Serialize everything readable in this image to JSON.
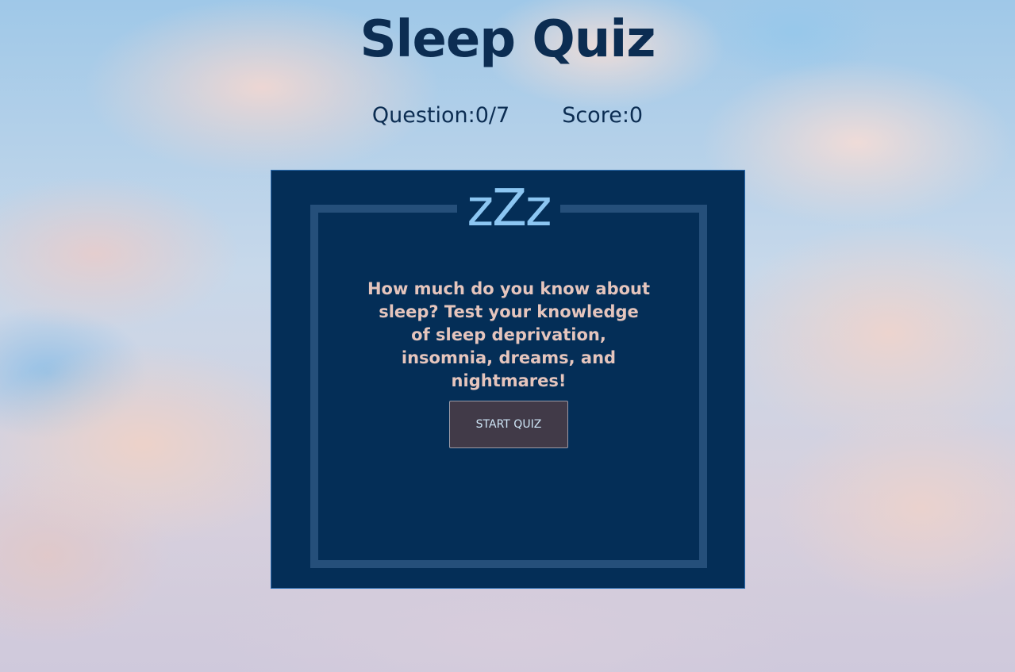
{
  "header": {
    "title": "Sleep Quiz"
  },
  "stats": {
    "question_label": "Question:",
    "question_value": "0/7",
    "score_label": "Score:",
    "score_value": "0"
  },
  "card": {
    "logo_text": "zZz",
    "intro_text": "How much do you know about sleep? Test your knowledge of sleep deprivation, insomnia, dreams, and nightmares!",
    "start_button_label": "START QUIZ"
  },
  "colors": {
    "title": "#0c2d52",
    "card_background": "#042e57",
    "card_frame": "#254f7a",
    "logo": "#8cc6f2",
    "intro_text": "#e5c5bd",
    "button_background": "#413a48",
    "button_text": "#cfe6f7"
  },
  "background": {
    "description_icon": "cloudy-sky-background"
  }
}
